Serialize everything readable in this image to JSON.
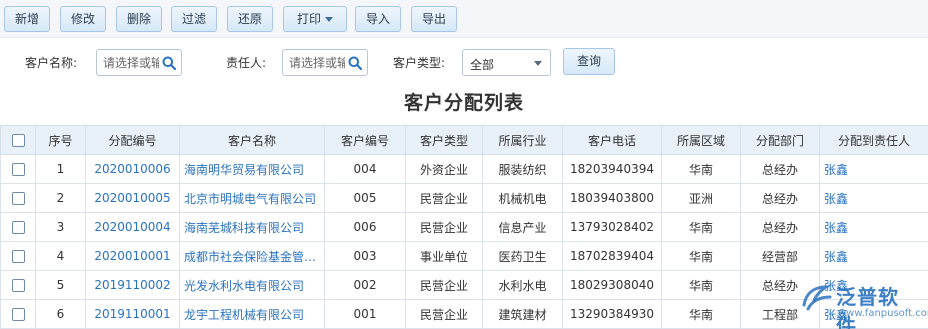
{
  "toolbar": {
    "buttons": [
      {
        "label": "新增"
      },
      {
        "label": "修改"
      },
      {
        "label": "删除"
      },
      {
        "label": "过滤"
      },
      {
        "label": "还原"
      },
      {
        "label": "打印"
      },
      {
        "label": "导入"
      },
      {
        "label": "导出"
      }
    ]
  },
  "filters": {
    "customer_name_label": "客户名称:",
    "customer_name_placeholder": "请选择或输",
    "owner_label": "责任人:",
    "owner_placeholder": "请选择或输",
    "customer_type_label": "客户类型:",
    "customer_type_value": "全部",
    "query_label": "查询"
  },
  "page_title": "客户分配列表",
  "table": {
    "headers": [
      "序号",
      "分配编号",
      "客户名称",
      "客户编号",
      "客户类型",
      "所属行业",
      "客户电话",
      "所属区域",
      "分配部门",
      "分配到责任人"
    ],
    "rows": [
      {
        "no": "1",
        "code": "2020010006",
        "name": "海南明华贸易有限公司",
        "cust_no": "004",
        "type": "外资企业",
        "industry": "服装纺织",
        "phone": "18203940394",
        "region": "华南",
        "dept": "总经办",
        "owner": "张鑫"
      },
      {
        "no": "2",
        "code": "2020010005",
        "name": "北京市明城电气有限公司",
        "cust_no": "005",
        "type": "民营企业",
        "industry": "机械机电",
        "phone": "18039403800",
        "region": "亚洲",
        "dept": "总经办",
        "owner": "张鑫"
      },
      {
        "no": "3",
        "code": "2020010004",
        "name": "海南芜城科技有限公司",
        "cust_no": "006",
        "type": "民营企业",
        "industry": "信息产业",
        "phone": "13793028402",
        "region": "华南",
        "dept": "总经办",
        "owner": "张鑫"
      },
      {
        "no": "4",
        "code": "2020010001",
        "name": "成都市社会保险基金管理局",
        "cust_no": "003",
        "type": "事业单位",
        "industry": "医药卫生",
        "phone": "18702839404",
        "region": "华南",
        "dept": "经营部",
        "owner": "张鑫"
      },
      {
        "no": "5",
        "code": "2019110002",
        "name": "光发水利水电有限公司",
        "cust_no": "002",
        "type": "民营企业",
        "industry": "水利水电",
        "phone": "18029308040",
        "region": "华南",
        "dept": "总经办",
        "owner": "张鑫"
      },
      {
        "no": "6",
        "code": "2019110001",
        "name": "龙宇工程机械有限公司",
        "cust_no": "001",
        "type": "民营企业",
        "industry": "建筑建材",
        "phone": "13290384930",
        "region": "华南",
        "dept": "工程部",
        "owner": "张鑫"
      }
    ]
  },
  "watermark": {
    "brand": "泛普软件",
    "url": "www.fanpusoft.com"
  },
  "colors": {
    "link": "#2a73c0",
    "header_bg": "#e8f0f8",
    "button_border": "#a9c6e6"
  }
}
